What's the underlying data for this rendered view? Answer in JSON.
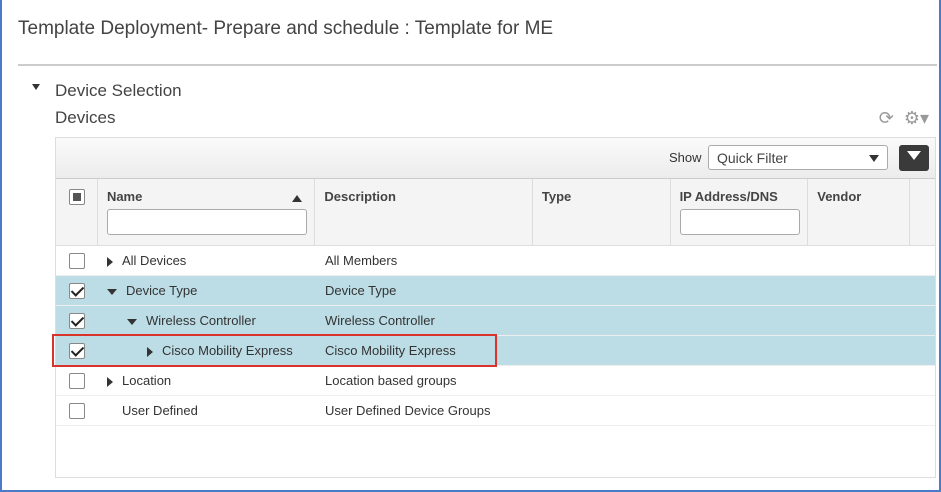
{
  "title": "Template Deployment- Prepare and schedule : Template for ME",
  "section": "Device Selection",
  "subsection": "Devices",
  "toolbar": {
    "show_label": "Show",
    "filter_value": "Quick Filter"
  },
  "columns": [
    "Name",
    "Description",
    "Type",
    "IP Address/DNS",
    "Vendor"
  ],
  "rows": [
    {
      "name": "All Devices",
      "description": "All Members",
      "checked": false,
      "indent": 0,
      "expander": "right"
    },
    {
      "name": "Device Type",
      "description": "Device Type",
      "checked": true,
      "indent": 0,
      "expander": "down"
    },
    {
      "name": "Wireless Controller",
      "description": "Wireless Controller",
      "checked": true,
      "indent": 1,
      "expander": "down"
    },
    {
      "name": "Cisco Mobility Express",
      "description": "Cisco Mobility Express",
      "checked": true,
      "indent": 2,
      "expander": "right"
    },
    {
      "name": "Location",
      "description": "Location based groups",
      "checked": false,
      "indent": 0,
      "expander": "right"
    },
    {
      "name": "User Defined",
      "description": "User Defined Device Groups",
      "checked": false,
      "indent": 0,
      "expander": "none"
    }
  ]
}
